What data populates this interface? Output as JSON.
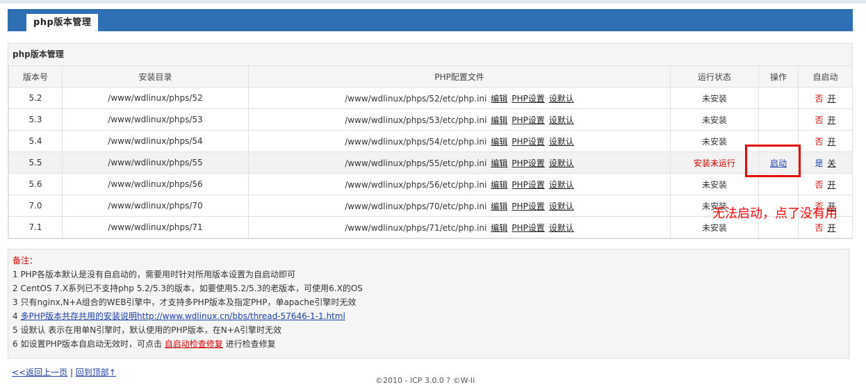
{
  "header": {
    "tab_label": "php版本管理"
  },
  "panel": {
    "title": "php版本管理",
    "columns": [
      "版本号",
      "安装目录",
      "PHP配置文件",
      "运行状态",
      "操作",
      "自启动"
    ],
    "rows": [
      {
        "version": "5.2",
        "dir": "/www/wdlinux/phps/52",
        "config": "/www/wdlinux/phps/52/etc/php.ini",
        "links": [
          "编辑",
          "PHP设置",
          "设默认"
        ],
        "status": "未安装",
        "action": "",
        "auto_a": "否",
        "auto_b": "开"
      },
      {
        "version": "5.3",
        "dir": "/www/wdlinux/phps/53",
        "config": "/www/wdlinux/phps/53/etc/php.ini",
        "links": [
          "编辑",
          "PHP设置",
          "设默认"
        ],
        "status": "未安装",
        "action": "",
        "auto_a": "否",
        "auto_b": "开"
      },
      {
        "version": "5.4",
        "dir": "/www/wdlinux/phps/54",
        "config": "/www/wdlinux/phps/54/etc/php.ini",
        "links": [
          "编辑",
          "PHP设置",
          "设默认"
        ],
        "status": "未安装",
        "action": "",
        "auto_a": "否",
        "auto_b": "开"
      },
      {
        "version": "5.5",
        "dir": "/www/wdlinux/phps/55",
        "config": "/www/wdlinux/phps/55/etc/php.ini",
        "links": [
          "编辑",
          "PHP设置",
          "设默认"
        ],
        "status": "安装未运行",
        "action": "启动",
        "auto_a": "是",
        "auto_b": "关"
      },
      {
        "version": "5.6",
        "dir": "/www/wdlinux/phps/56",
        "config": "/www/wdlinux/phps/56/etc/php.ini",
        "links": [
          "编辑",
          "PHP设置",
          "设默认"
        ],
        "status": "未安装",
        "action": "",
        "auto_a": "否",
        "auto_b": "开"
      },
      {
        "version": "7.0",
        "dir": "/www/wdlinux/phps/70",
        "config": "/www/wdlinux/phps/70/etc/php.ini",
        "links": [
          "编辑",
          "PHP设置",
          "设默认"
        ],
        "status": "未安装",
        "action": "",
        "auto_a": "否",
        "auto_b": "开"
      },
      {
        "version": "7.1",
        "dir": "/www/wdlinux/phps/71",
        "config": "/www/wdlinux/phps/71/etc/php.ini",
        "links": [
          "编辑",
          "PHP设置",
          "设默认"
        ],
        "status": "未安装",
        "action": "",
        "auto_a": "否",
        "auto_b": "开"
      }
    ]
  },
  "annotation": {
    "text": "无法启动，点了没有用"
  },
  "notes": {
    "title": "备注：",
    "line1": "1 PHP各版本默认是没有自启动的，需要用时针对所用版本设置为自启动即可",
    "line2": "2 CentOS 7.X系列已不支持php 5.2/5.3的版本，如要使用5.2/5.3的老版本，可使用6.X的OS",
    "line3": "3 只有nginx,N+A组合的WEB引擎中，才支持多PHP版本及指定PHP，单apache引擎时无效",
    "line4_prefix": "4 ",
    "line4_link": "多PHP版本共存共用的安装说明http://www.wdlinux.cn/bbs/thread-57646-1-1.html",
    "line5": "5 设默认 表示在用单N引擎时，默认使用的PHP版本，在N+A引擎时无效",
    "line6_prefix": "6 如设置PHP版本自启动无效时，可点击 ",
    "line6_link": "自启动检查修复",
    "line6_suffix": " 进行检查修复"
  },
  "footer": {
    "back_link": "<<返回上一页",
    "sep": " | ",
    "top_link": "回到顶部↑",
    "copyright": "©2010 - lCP  3.0.0 ? ©W-li"
  },
  "colors": {
    "tab_bar": "#2f6fb3",
    "red": "#d40000",
    "link_blue": "#1c3fa8",
    "annotation": "#ff0000"
  }
}
